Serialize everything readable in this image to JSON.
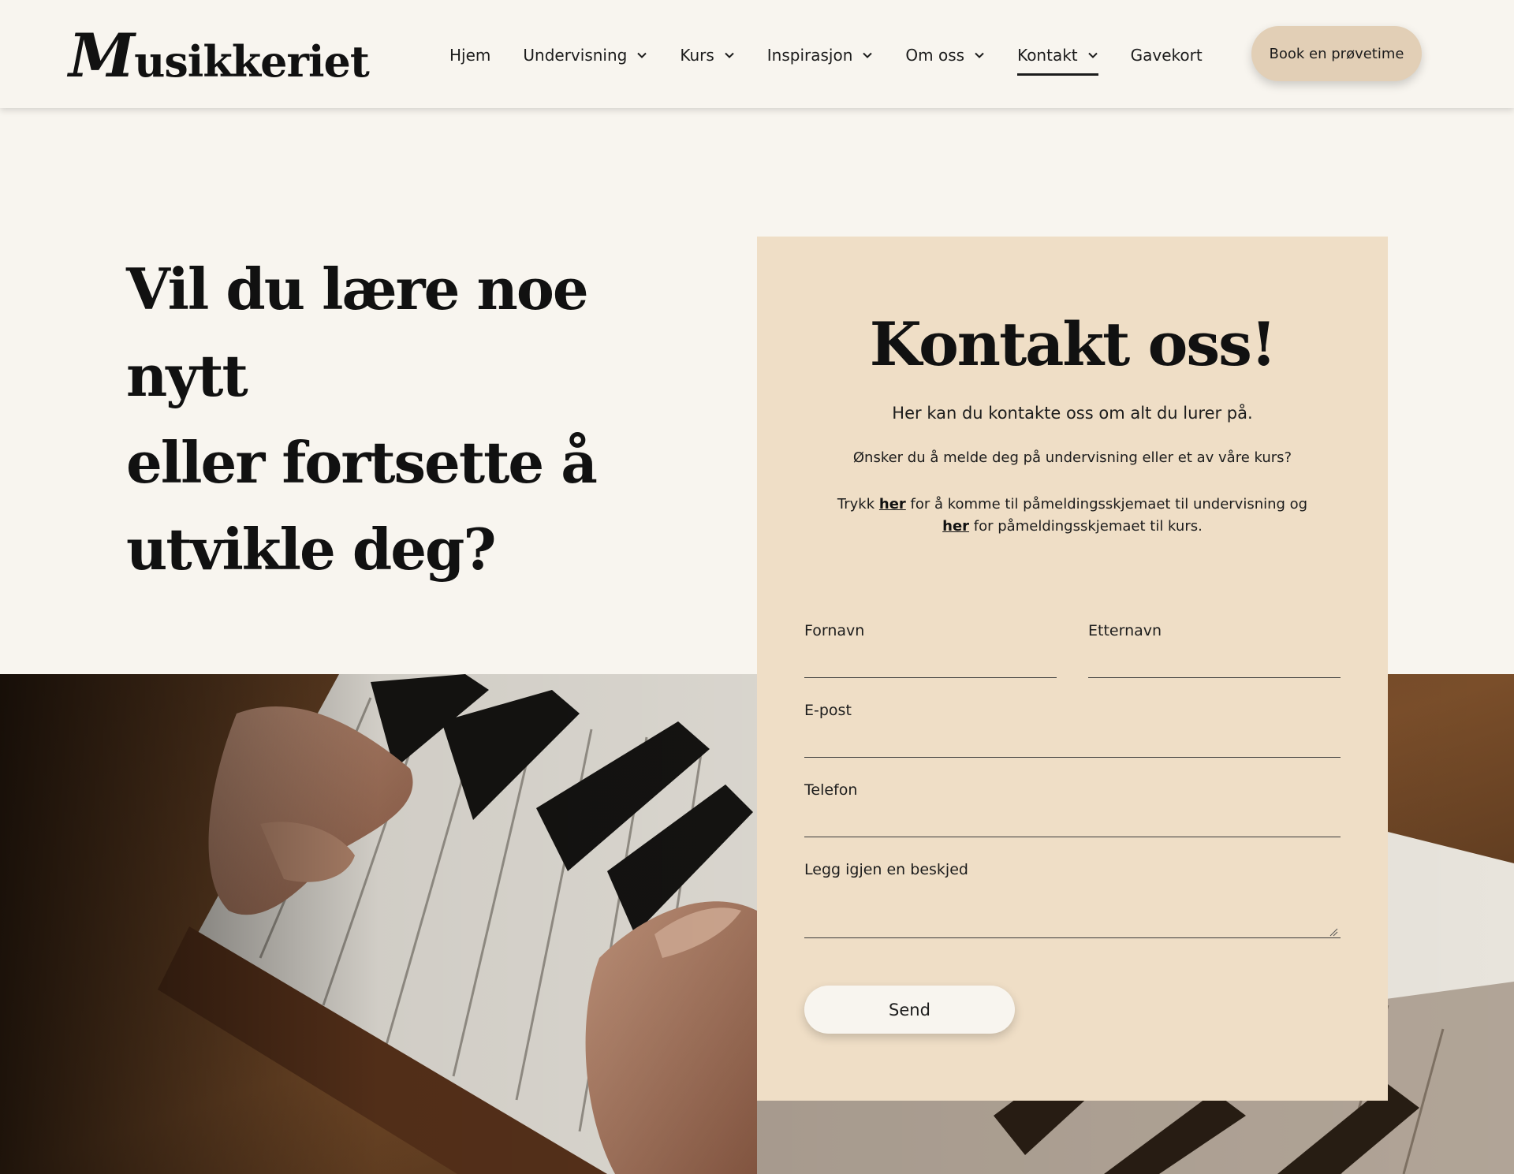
{
  "colors": {
    "background": "#f8f5ef",
    "card": "#efdec6",
    "book_button": "#e2cfb6",
    "text": "#141414"
  },
  "header": {
    "logo": "Musikkeriet",
    "nav": [
      {
        "label": "Hjem",
        "has_dropdown": false,
        "active": false
      },
      {
        "label": "Undervisning",
        "has_dropdown": true,
        "active": false
      },
      {
        "label": "Kurs",
        "has_dropdown": true,
        "active": false
      },
      {
        "label": "Inspirasjon",
        "has_dropdown": true,
        "active": false
      },
      {
        "label": "Om oss",
        "has_dropdown": true,
        "active": false
      },
      {
        "label": "Kontakt",
        "has_dropdown": true,
        "active": true
      },
      {
        "label": "Gavekort",
        "has_dropdown": false,
        "active": false
      }
    ],
    "book_button": "Book en prøvetime"
  },
  "hero": {
    "headline_lines": [
      "Vil du lære noe nytt",
      "eller fortsette å",
      "utvikle deg?"
    ]
  },
  "contact": {
    "title": "Kontakt oss!",
    "subtitle": "Her kan du kontakte oss om alt du lurer på.",
    "question": "Ønsker du å melde deg på undervisning eller et av våre kurs?",
    "links_text": {
      "part1": "Trykk ",
      "link1": "her",
      "part2": " for å komme til påmeldingsskjemaet til undervisning og ",
      "link2": "her",
      "part3": " for påmeldingsskjemaet til kurs."
    },
    "fields": {
      "first_name": "Fornavn",
      "last_name": "Etternavn",
      "email": "E-post",
      "phone": "Telefon",
      "message": "Legg igjen en beskjed"
    },
    "send_button": "Send"
  },
  "icons": {
    "nav_dropdown": "chevron-down-icon",
    "textarea_resize": "resize-grip-icon"
  }
}
